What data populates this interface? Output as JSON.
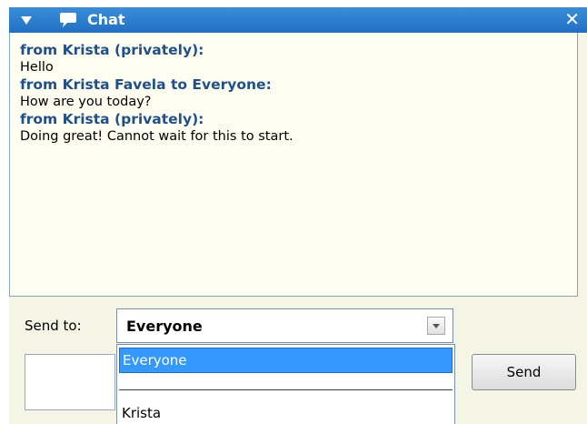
{
  "window": {
    "title": "Chat",
    "icons": {
      "collapse": "chevron-down-icon",
      "chat": "chat-bubble-icon",
      "close": "close-icon"
    },
    "colors": {
      "titlebar": "#2b7fd0",
      "panel_bg": "#fdfdf0",
      "sender_text": "#1f5089",
      "selection": "#3399ff"
    }
  },
  "messages": [
    {
      "header": "from Krista (privately):",
      "body": "Hello"
    },
    {
      "header": "from Krista Favela to Everyone:",
      "body": "How are you today?"
    },
    {
      "header": "from Krista (privately):",
      "body": "Doing great! Cannot wait for this to start."
    }
  ],
  "compose": {
    "send_to_label": "Send to:",
    "selected_recipient": "Everyone",
    "options": [
      "Everyone",
      "",
      "Krista"
    ],
    "send_label": "Send",
    "message_value": ""
  }
}
